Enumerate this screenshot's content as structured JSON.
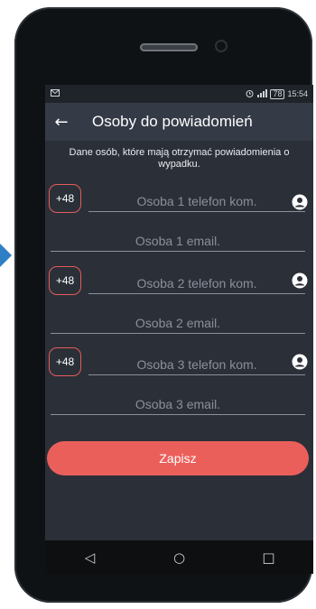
{
  "status": {
    "time": "15:54",
    "battery": "78"
  },
  "appbar": {
    "back_icon": "arrow-left-icon",
    "title": "Osoby do powiadomień"
  },
  "description": "Dane osób, które mają otrzymać powiadomienia o wypadku.",
  "contacts": [
    {
      "prefix": "+48",
      "phone_placeholder": "Osoba 1 telefon kom.",
      "email_placeholder": "Osoba 1 email."
    },
    {
      "prefix": "+48",
      "phone_placeholder": "Osoba 2 telefon kom.",
      "email_placeholder": "Osoba 2 email."
    },
    {
      "prefix": "+48",
      "phone_placeholder": "Osoba 3 telefon kom.",
      "email_placeholder": "Osoba 3 email."
    }
  ],
  "save_label": "Zapisz",
  "nav": {
    "back": "◁",
    "home": "○",
    "recents": "□"
  },
  "colors": {
    "accent": "#eb5f5b",
    "background": "#2b2f38",
    "appbar": "#343a46"
  }
}
